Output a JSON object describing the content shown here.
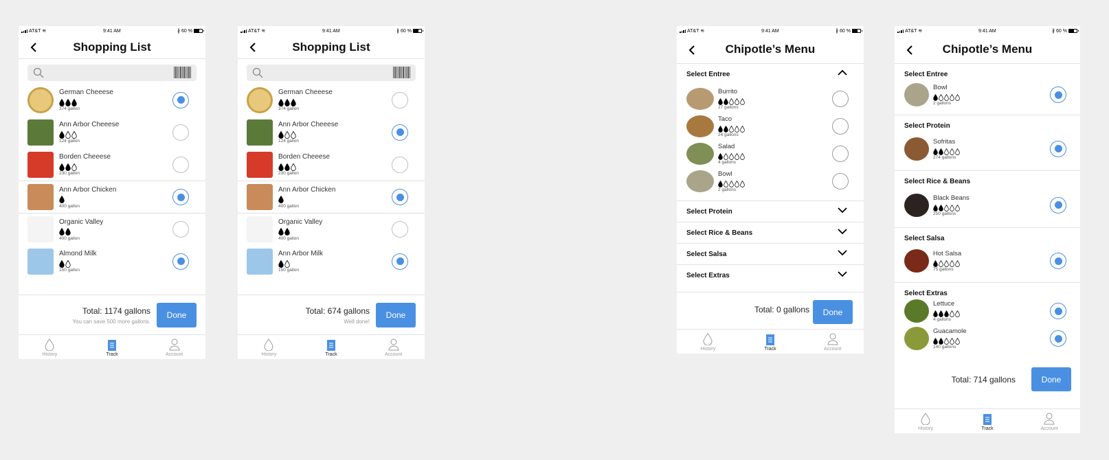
{
  "status": {
    "carrier": "AT&T",
    "time": "9:41 AM",
    "battery": "60 %"
  },
  "tabs": [
    {
      "label": "History",
      "icon": "drop-icon"
    },
    {
      "label": "Track",
      "icon": "document-icon"
    },
    {
      "label": "Account",
      "icon": "person-icon"
    }
  ],
  "accent": "#4a90e2",
  "screen1": {
    "title": "Shopping List",
    "items": [
      {
        "name": "German Cheeese",
        "drops": [
          1,
          1,
          1
        ],
        "gallons": "374 gallon",
        "selected": true
      },
      {
        "name": "Ann Arbor Cheeese",
        "drops": [
          1,
          0,
          0
        ],
        "gallons": "124 gallon",
        "selected": false
      },
      {
        "name": "Borden Cheeese",
        "drops": [
          1,
          1,
          0
        ],
        "gallons": "230 gallon",
        "selected": false
      },
      {
        "name": "Ann Arbor Chicken",
        "drops": [
          1
        ],
        "gallons": "400 gallon",
        "selected": true
      },
      {
        "name": "Organic Valley",
        "drops": [
          1,
          1
        ],
        "gallons": "400 gallon",
        "selected": false
      },
      {
        "name": "Almond Milk",
        "drops": [
          1,
          0
        ],
        "gallons": "150 gallon",
        "selected": true
      }
    ],
    "total": "Total: 1174 gallons",
    "sub": "You can save 500 more gallons.",
    "done": "Done"
  },
  "screen2": {
    "title": "Shopping List",
    "items": [
      {
        "name": "German Cheeese",
        "drops": [
          1,
          1,
          1
        ],
        "gallons": "374 gallon",
        "selected": false
      },
      {
        "name": "Ann Arbor Cheeese",
        "drops": [
          1,
          0,
          0
        ],
        "gallons": "124 gallon",
        "selected": true
      },
      {
        "name": "Borden Cheeese",
        "drops": [
          1,
          1,
          0
        ],
        "gallons": "230 gallon",
        "selected": false
      },
      {
        "name": "Ann Arbor Chicken",
        "drops": [
          1
        ],
        "gallons": "400 gallon",
        "selected": true
      },
      {
        "name": "Organic Valley",
        "drops": [
          1,
          1
        ],
        "gallons": "400 gallon",
        "selected": false
      },
      {
        "name": "Ann Arbor Milk",
        "drops": [
          1,
          0
        ],
        "gallons": "150 gallon",
        "selected": true
      }
    ],
    "total": "Total: 674 gallons",
    "sub": "Well done!",
    "done": "Done"
  },
  "screen3": {
    "title": "Chipotle’s Menu",
    "entree_header": "Select Entree",
    "entrees": [
      {
        "name": "Burrito",
        "drops": [
          1,
          1,
          0,
          0,
          0
        ],
        "gallons": "27 gallons",
        "selected": false
      },
      {
        "name": "Taco",
        "drops": [
          1,
          1,
          0,
          0,
          0
        ],
        "gallons": "24 gallons",
        "selected": false
      },
      {
        "name": "Salad",
        "drops": [
          1,
          0,
          0,
          0,
          0
        ],
        "gallons": "4 gallons",
        "selected": false
      },
      {
        "name": "Bowl",
        "drops": [
          1,
          0,
          0,
          0,
          0
        ],
        "gallons": "2 gallons",
        "selected": false
      }
    ],
    "sections": [
      "Select Protein",
      "Select Rice & Beans",
      "Select Salsa",
      "Select Extras"
    ],
    "total": "Total: 0 gallons",
    "done": "Done"
  },
  "screen4": {
    "title": "Chipotle’s Menu",
    "sections": [
      {
        "header": "Select Entree",
        "items": [
          {
            "name": "Bowl",
            "drops": [
              1,
              0,
              0,
              0,
              0
            ],
            "gallons": "2 gallons",
            "selected": true
          }
        ]
      },
      {
        "header": "Select Protein",
        "items": [
          {
            "name": "Sofritas",
            "drops": [
              1,
              1,
              0,
              0,
              0
            ],
            "gallons": "274 gallons",
            "selected": true
          }
        ]
      },
      {
        "header": "Select Rice & Beans",
        "items": [
          {
            "name": "Black Beans",
            "drops": [
              1,
              1,
              0,
              0,
              0
            ],
            "gallons": "250 gallons",
            "selected": true
          }
        ]
      },
      {
        "header": "Select Salsa",
        "items": [
          {
            "name": "Hot Salsa",
            "drops": [
              1,
              0,
              0,
              0,
              0
            ],
            "gallons": "75 gallons",
            "selected": true
          }
        ]
      },
      {
        "header": "Select Extras",
        "items": [
          {
            "name": "Lettuce",
            "drops": [
              1,
              1,
              1,
              0,
              0
            ],
            "gallons": "4 gallons",
            "selected": true
          },
          {
            "name": "Guacamole",
            "drops": [
              1,
              1,
              0,
              0,
              0
            ],
            "gallons": "140 gallons",
            "selected": true
          }
        ]
      }
    ],
    "total": "Total: 714 gallons",
    "done": "Done"
  }
}
